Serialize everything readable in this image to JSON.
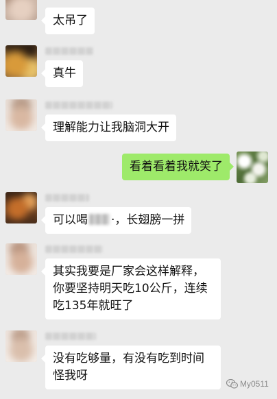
{
  "theme": {
    "background": "#ebebeb",
    "bubble_received": "#ffffff",
    "bubble_sent": "#9eea6a",
    "text": "#111111",
    "watermark": "#8c8c8c"
  },
  "icons": {
    "avatar": "avatar-icon",
    "watermark": "wechat-logo-icon"
  },
  "messages": [
    {
      "lines": [
        "太吊了"
      ]
    },
    {
      "lines": [
        "真牛"
      ]
    },
    {
      "lines": [
        "理解能力让我脑洞大开"
      ]
    },
    {
      "lines": [
        "看着看着我就笑了"
      ]
    },
    {
      "segments": [
        "可以喝",
        "·，长翅膀一拼"
      ]
    },
    {
      "lines": [
        "其实我要是厂家会这样解释，",
        "你要坚持明天吃10公斤，连续",
        "吃135年就旺了"
      ]
    },
    {
      "lines": [
        "没有吃够量，有没有吃到时间",
        "怪我呀"
      ]
    }
  ],
  "watermark": {
    "text": "My0511"
  }
}
